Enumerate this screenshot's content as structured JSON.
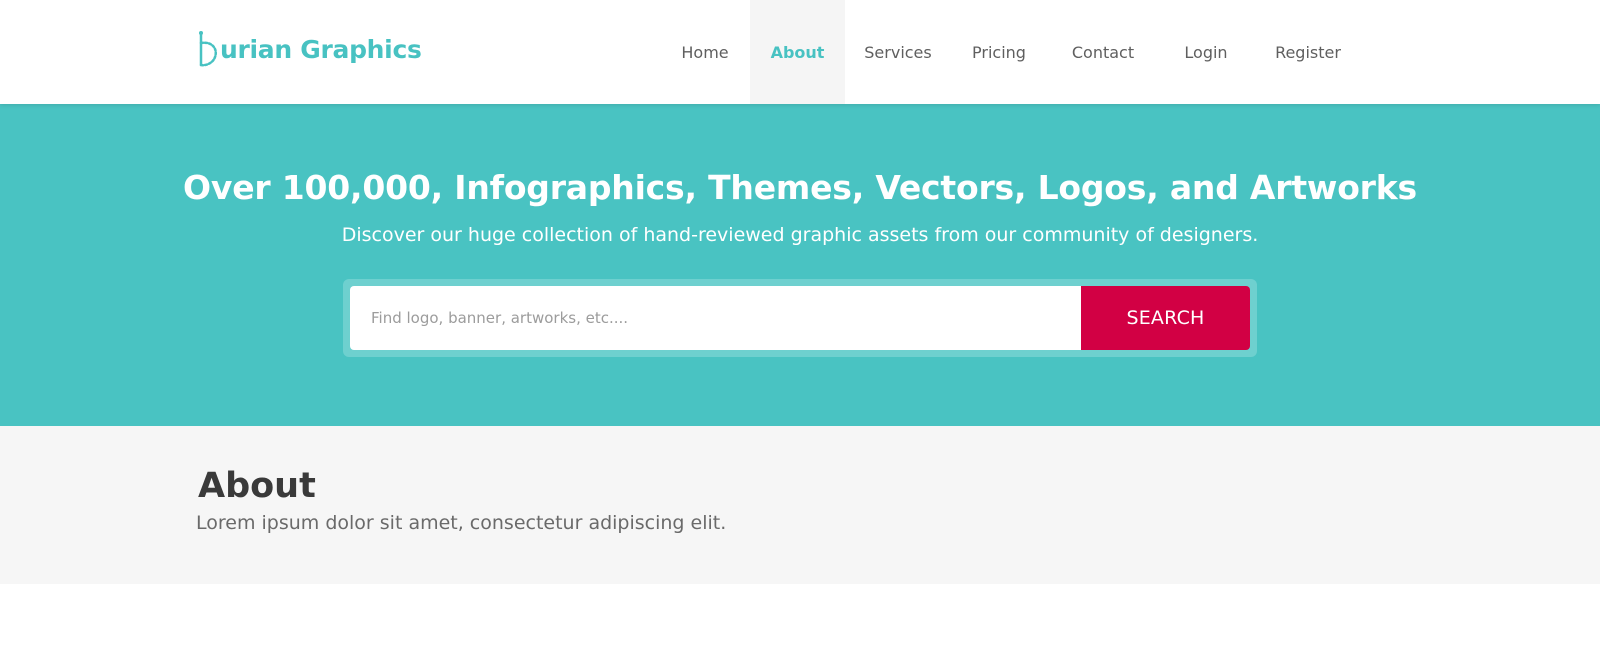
{
  "header": {
    "logo_text": "urian Graphics",
    "logo_initial": "D",
    "brand_color": "#48c2c2",
    "nav": [
      {
        "label": "Home",
        "active": false
      },
      {
        "label": "About",
        "active": true
      },
      {
        "label": "Services",
        "active": false
      },
      {
        "label": "Pricing",
        "active": false
      },
      {
        "label": "Contact",
        "active": false
      },
      {
        "label": "Login",
        "active": false
      },
      {
        "label": "Register",
        "active": false
      }
    ]
  },
  "hero": {
    "background": "#49c3c2",
    "title": "Over 100,000, Infographics, Themes, Vectors, Logos, and Artworks",
    "subtitle": "Discover our huge collection of hand-reviewed graphic assets from our community of designers.",
    "search": {
      "placeholder": "Find logo, banner, artworks, etc....",
      "value": "",
      "button_label": "SEARCH",
      "button_color": "#d20044"
    }
  },
  "about": {
    "title": "About",
    "text": "Lorem ipsum dolor sit amet, consectetur adipiscing elit."
  }
}
